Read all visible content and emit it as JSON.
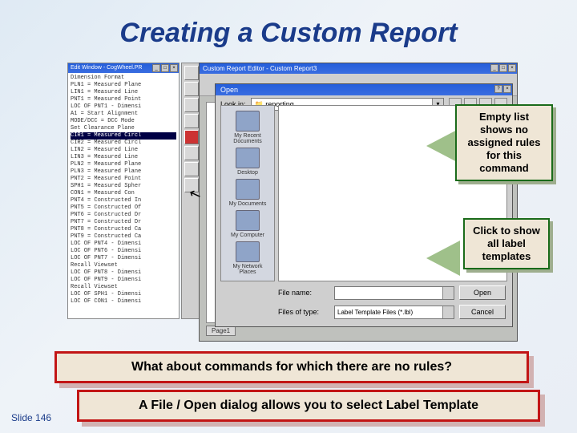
{
  "title": "Creating a Custom Report",
  "slide_number": "Slide 146",
  "edit_window": {
    "title": "Edit Window - CogWheel.PR",
    "lines": [
      "Dimension Format",
      "PLN1 = Measured Plane",
      "LIN1 = Measured Line",
      "PNT1 = Measured Point",
      "LOC OF PNT1 - Dimensi",
      "A1 = Start Alignment",
      "MODE/DCC = DCC Mode",
      "Set Clearance Plane",
      "CIR1 = Measured Circl",
      "CIR2 = Measured Circl",
      "LIN2 = Measured Line",
      "LIN3 = Measured Line",
      "PLN2 = Measured Plane",
      "PLN3 = Measured Plane",
      "PNT2 = Measured Point",
      "SPH1 = Measured Spher",
      "CON1 = Measured Con",
      "PNT4 = Constructed In",
      "PNT5 = Constructed Of",
      "PNT6 = Constructed Dr",
      "PNT7 = Constructed Dr",
      "PNT8 = Constructed Ca",
      "PNT9 = Constructed Ca",
      "LOC OF PNT4 - Dimensi",
      "LOC OF PNT6 - Dimensi",
      "LOC OF PNT7 - Dimensi",
      "Recall Viewset",
      "LOC OF PNT8 - Dimensi",
      "LOC OF PNT9 - Dimensi",
      "Recall Viewset",
      "LOC OF SPH1 - Dimensi",
      "LOC OF CON1 - Dimensi"
    ],
    "highlight_index": 8
  },
  "cre_window": {
    "title": "Custom Report Editor - Custom Report3",
    "page_tab": "Page1"
  },
  "open_dialog": {
    "title": "Open",
    "lookin_label": "Look in:",
    "lookin_value": "reporting",
    "places": [
      "My Recent Documents",
      "Desktop",
      "My Documents",
      "My Computer",
      "My Network Places"
    ],
    "filename_label": "File name:",
    "filename_value": "",
    "filter_label": "Files of type:",
    "filter_value": "Label Template Files (*.lbl)",
    "open_btn": "Open",
    "cancel_btn": "Cancel"
  },
  "callouts": {
    "empty_list": "Empty list shows no assigned rules for this command",
    "click_show": "Click to show all label templates"
  },
  "redbox1": "What about commands for which there are no rules?",
  "redbox2": "A File / Open dialog allows you to select Label Template",
  "icons": {
    "folder": "📁"
  }
}
